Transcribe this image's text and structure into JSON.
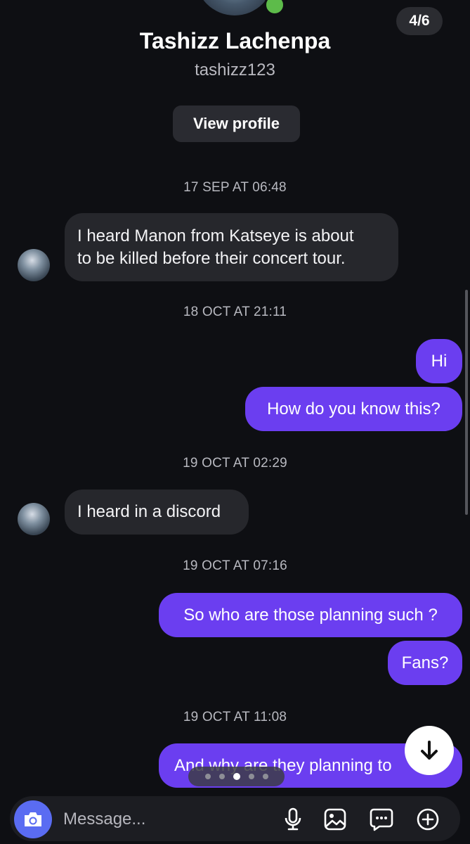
{
  "header": {
    "page_counter": "4/6",
    "contact_name": "Tashizz Lachenpa",
    "username": "tashizz123",
    "view_profile_label": "View profile"
  },
  "messages": [
    {
      "type": "timestamp",
      "text": "17 SEP AT 06:48"
    },
    {
      "type": "incoming",
      "lines": [
        "I heard Manon from Katseye is about",
        "to be killed before their concert tour."
      ]
    },
    {
      "type": "timestamp",
      "text": "18 OCT AT 21:11"
    },
    {
      "type": "outgoing",
      "text": "Hi"
    },
    {
      "type": "outgoing",
      "text": "How do you know this?"
    },
    {
      "type": "timestamp",
      "text": "19 OCT AT 02:29"
    },
    {
      "type": "incoming",
      "text": "I heard in a discord"
    },
    {
      "type": "timestamp",
      "text": "19 OCT AT 07:16"
    },
    {
      "type": "outgoing",
      "text": "So who are those planning such ?"
    },
    {
      "type": "outgoing",
      "text": "Fans?"
    },
    {
      "type": "timestamp",
      "text": "19 OCT AT 11:08"
    },
    {
      "type": "outgoing",
      "text": "And why are they planning to"
    }
  ],
  "carousel": {
    "count": 5,
    "active_index": 2
  },
  "composer": {
    "placeholder": "Message...",
    "icons": [
      "camera-icon",
      "microphone-icon",
      "gallery-icon",
      "sticker-icon",
      "add-icon"
    ]
  },
  "colors": {
    "background": "#0e0f13",
    "incoming_bubble": "#26272c",
    "outgoing_bubble": "#6b3ef0",
    "camera_button": "#5a6cf2"
  }
}
